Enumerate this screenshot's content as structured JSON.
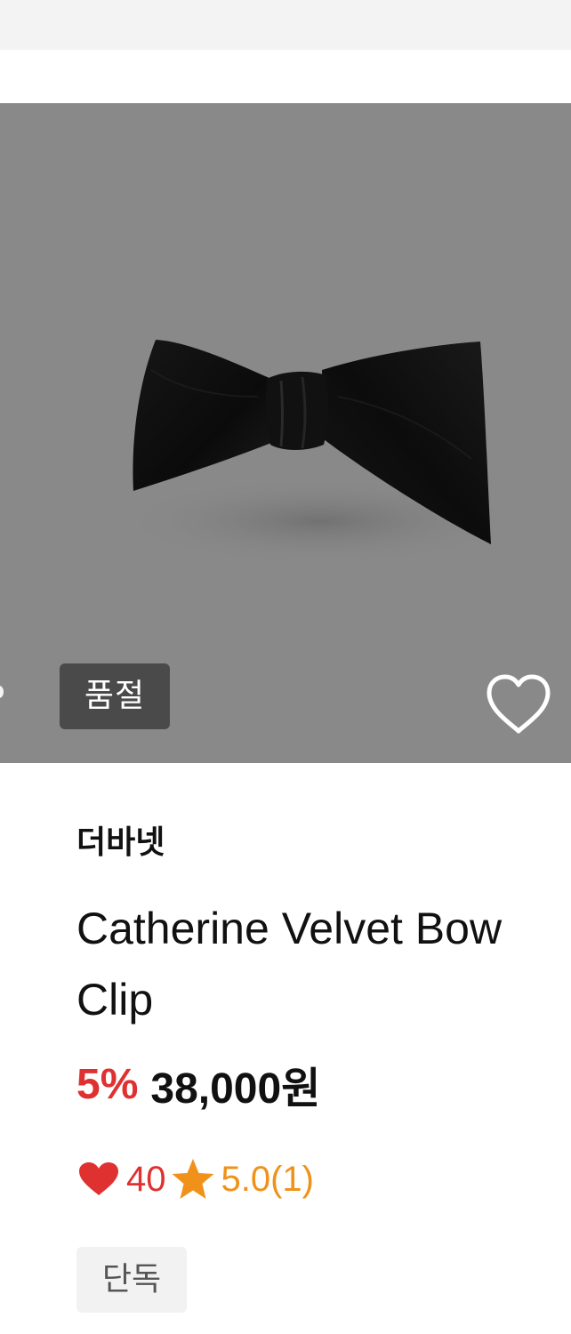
{
  "product": {
    "soldout_badge": "품절",
    "brand": "더바넷",
    "name": "Catherine Velvet Bow Clip",
    "discount": "5%",
    "price": "38,000원",
    "likes": "40",
    "rating": "5.0(1)",
    "tag": "단독",
    "wishlisted": false
  },
  "colors": {
    "image_background": "#898989",
    "discount": "#e03131",
    "like": "#e03131",
    "rating": "#f0921a",
    "badge_background": "#4a4a4a",
    "tag_background": "#f2f2f2"
  },
  "icons": {
    "wishlist": "heart-outline-icon",
    "like": "heart-filled-icon",
    "rating": "star-icon"
  }
}
